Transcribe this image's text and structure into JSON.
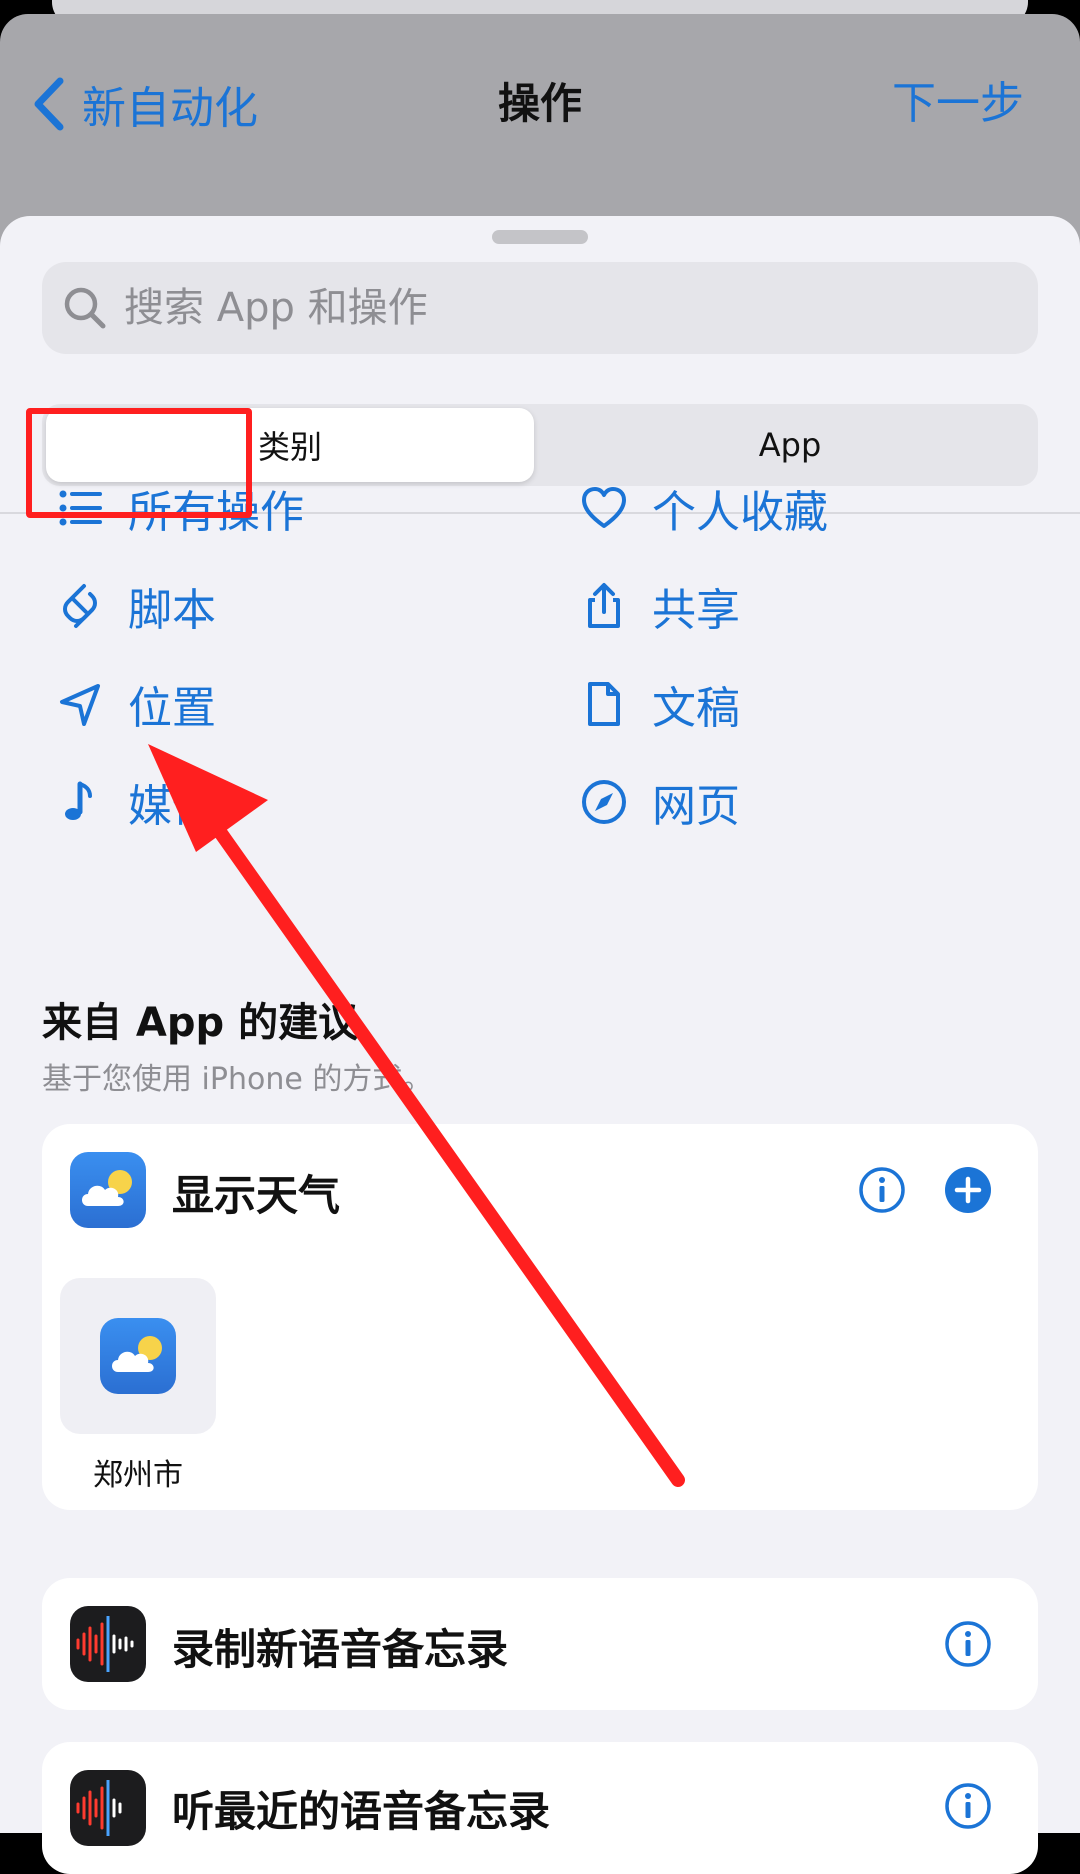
{
  "header": {
    "back_label": "新自动化",
    "title": "操作",
    "next_label": "下一步"
  },
  "search": {
    "placeholder": "搜索 App 和操作"
  },
  "segmented": {
    "left": "类别",
    "right": "App"
  },
  "categories": [
    {
      "label": "所有操作",
      "icon": "list-icon"
    },
    {
      "label": "个人收藏",
      "icon": "heart-icon"
    },
    {
      "label": "脚本",
      "icon": "script-icon"
    },
    {
      "label": "共享",
      "icon": "share-icon"
    },
    {
      "label": "位置",
      "icon": "location-icon"
    },
    {
      "label": "文稿",
      "icon": "document-icon"
    },
    {
      "label": "媒体",
      "icon": "music-note-icon"
    },
    {
      "label": "网页",
      "icon": "compass-icon"
    }
  ],
  "suggestions": {
    "title": "来自 App 的建议",
    "subtitle": "基于您使用 iPhone 的方式。",
    "items": [
      {
        "title": "显示天气",
        "tile_label": "郑州市",
        "icon": "weather-icon"
      },
      {
        "title": "录制新语音备忘录",
        "icon": "voice-memo-icon"
      },
      {
        "title": "听最近的语音备忘录",
        "icon": "voice-memo-icon"
      }
    ]
  },
  "colors": {
    "accent": "#1b74d6",
    "annotation": "#ff1f1f"
  }
}
